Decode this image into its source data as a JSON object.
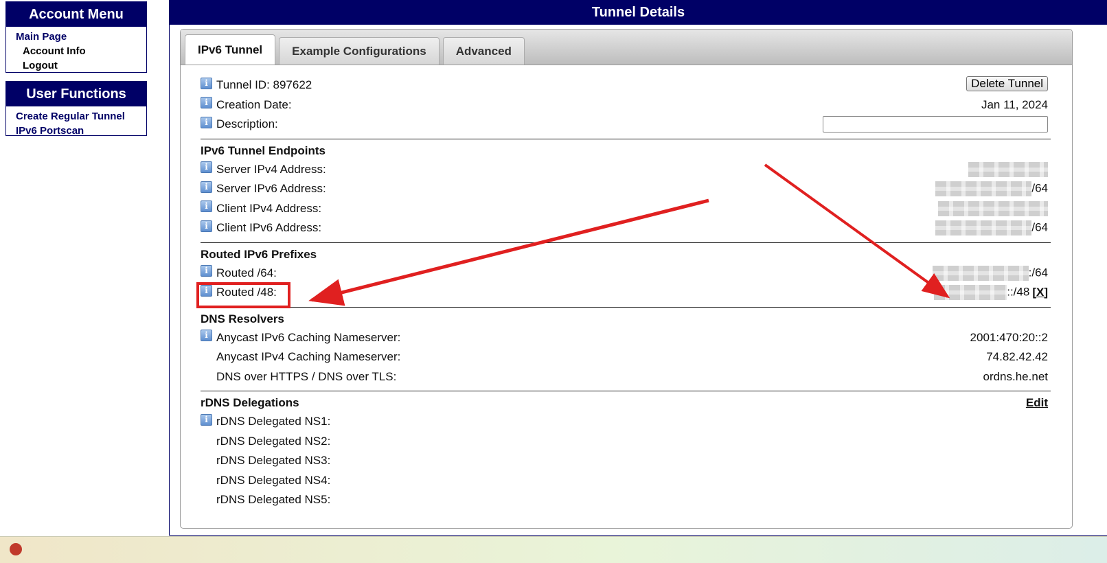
{
  "account_menu": {
    "title": "Account Menu",
    "items": [
      "Main Page",
      "Account Info",
      "Logout"
    ]
  },
  "user_functions": {
    "title": "User Functions",
    "items": [
      "Create Regular Tunnel",
      "IPv6 Portscan"
    ]
  },
  "main": {
    "title": "Tunnel Details",
    "tabs": [
      "IPv6 Tunnel",
      "Example Configurations",
      "Advanced"
    ],
    "active_tab": "IPv6 Tunnel"
  },
  "tunnel": {
    "id_label": "Tunnel ID: 897622",
    "delete_label": "Delete Tunnel",
    "creation_label": "Creation Date:",
    "creation_value": "Jan 11, 2024",
    "description_label": "Description:",
    "description_value": ""
  },
  "endpoints": {
    "title": "IPv6 Tunnel Endpoints",
    "server_ipv4_label": "Server IPv4 Address:",
    "server_ipv6_label": "Server IPv6 Address:",
    "server_ipv6_suffix": "/64",
    "client_ipv4_label": "Client IPv4 Address:",
    "client_ipv6_label": "Client IPv6 Address:",
    "client_ipv6_suffix": "/64"
  },
  "prefixes": {
    "title": "Routed IPv6 Prefixes",
    "routed64_label": "Routed /64:",
    "routed64_suffix": ":/64",
    "routed48_label": "Routed /48:",
    "routed48_suffix": "::/48",
    "remove_label": "[X]"
  },
  "dns": {
    "title": "DNS Resolvers",
    "anycast_v6_label": "Anycast IPv6 Caching Nameserver:",
    "anycast_v6_value": "2001:470:20::2",
    "anycast_v4_label": "Anycast IPv4 Caching Nameserver:",
    "anycast_v4_value": "74.82.42.42",
    "doh_label": "DNS over HTTPS / DNS over TLS:",
    "doh_value": "ordns.he.net"
  },
  "rdns": {
    "title": "rDNS Delegations",
    "edit_label": "Edit",
    "ns1": "rDNS Delegated NS1:",
    "ns2": "rDNS Delegated NS2:",
    "ns3": "rDNS Delegated NS3:",
    "ns4": "rDNS Delegated NS4:",
    "ns5": "rDNS Delegated NS5:"
  },
  "icons": {
    "info": "i"
  },
  "colors": {
    "header": "#000066",
    "annotation": "#e02020"
  }
}
